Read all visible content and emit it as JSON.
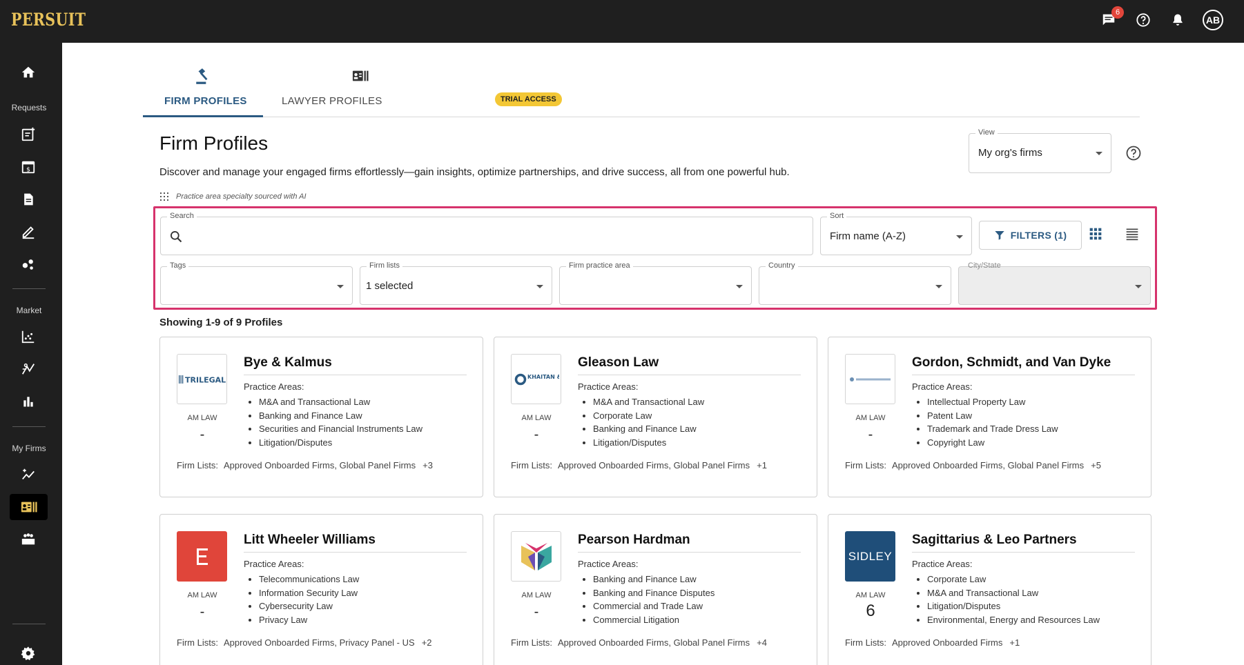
{
  "app": {
    "logo": "PERSUIT",
    "chat_badge": "6",
    "avatar_initials": "AB"
  },
  "sidebar": {
    "section_requests": "Requests",
    "section_market": "Market",
    "section_my_firms": "My Firms"
  },
  "tabs": [
    {
      "label": "FIRM PROFILES"
    },
    {
      "label": "LAWYER PROFILES",
      "badge": "TRIAL ACCESS"
    }
  ],
  "page": {
    "title": "Firm Profiles",
    "description": "Discover and manage your engaged firms effortlessly—gain insights, optimize partnerships, and drive success, all from one powerful hub.",
    "ai_note": "Practice area specialty sourced with AI",
    "view": {
      "label": "View",
      "value": "My org's firms"
    }
  },
  "filters": {
    "search": {
      "label": "Search",
      "value": ""
    },
    "sort": {
      "label": "Sort",
      "value": "Firm name (A-Z)"
    },
    "filters_button": "FILTERS (1)",
    "tags": {
      "label": "Tags",
      "value": ""
    },
    "firm_lists": {
      "label": "Firm lists",
      "value": "1 selected"
    },
    "practice_area": {
      "label": "Firm practice area",
      "value": ""
    },
    "country": {
      "label": "Country",
      "value": ""
    },
    "city_state": {
      "label": "City/State",
      "value": ""
    }
  },
  "results": {
    "showing": "Showing 1-9 of 9 Profiles",
    "am_law_label": "AM LAW",
    "practice_areas_label": "Practice Areas:",
    "firm_lists_label": "Firm Lists:",
    "cards": [
      {
        "name": "Bye & Kalmus",
        "logo": "TRILEGAL",
        "rank": "-",
        "areas": [
          "M&A and Transactional Law",
          "Banking and Finance Law",
          "Securities and Financial Instruments Law",
          "Litigation/Disputes"
        ],
        "lists": "Approved Onboarded Firms, Global Panel Firms",
        "more": "+3"
      },
      {
        "name": "Gleason Law",
        "logo": "KHAITAN & CO",
        "rank": "-",
        "areas": [
          "M&A and Transactional Law",
          "Corporate Law",
          "Banking and Finance Law",
          "Litigation/Disputes"
        ],
        "lists": "Approved Onboarded Firms, Global Panel Firms",
        "more": "+1"
      },
      {
        "name": "Gordon, Schmidt, and Van Dyke",
        "logo": "",
        "rank": "-",
        "areas": [
          "Intellectual Property Law",
          "Patent Law",
          "Trademark and Trade Dress Law",
          "Copyright Law"
        ],
        "lists": "Approved Onboarded Firms, Global Panel Firms",
        "more": "+5"
      },
      {
        "name": "Litt Wheeler Williams",
        "logo": "",
        "rank": "-",
        "areas": [
          "Telecommunications Law",
          "Information Security Law",
          "Cybersecurity Law",
          "Privacy Law"
        ],
        "lists": "Approved Onboarded Firms, Privacy Panel - US",
        "more": "+2"
      },
      {
        "name": "Pearson Hardman",
        "logo": "",
        "rank": "-",
        "areas": [
          "Banking and Finance Law",
          "Banking and Finance Disputes",
          "Commercial and Trade Law",
          "Commercial Litigation"
        ],
        "lists": "Approved Onboarded Firms, Global Panel Firms",
        "more": "+4"
      },
      {
        "name": "Sagittarius & Leo Partners",
        "logo": "SIDLEY",
        "rank": "6",
        "areas": [
          "Corporate Law",
          "M&A and Transactional Law",
          "Litigation/Disputes",
          "Environmental, Energy and Resources Law"
        ],
        "lists": "Approved Onboarded Firms",
        "more": "+1"
      }
    ]
  },
  "colors": {
    "topbar": "#1f1f1f",
    "accent": "#2b5a82",
    "highlight": "#d6336c",
    "trial_badge": "#f3c735",
    "logo": "#e8c25a"
  }
}
